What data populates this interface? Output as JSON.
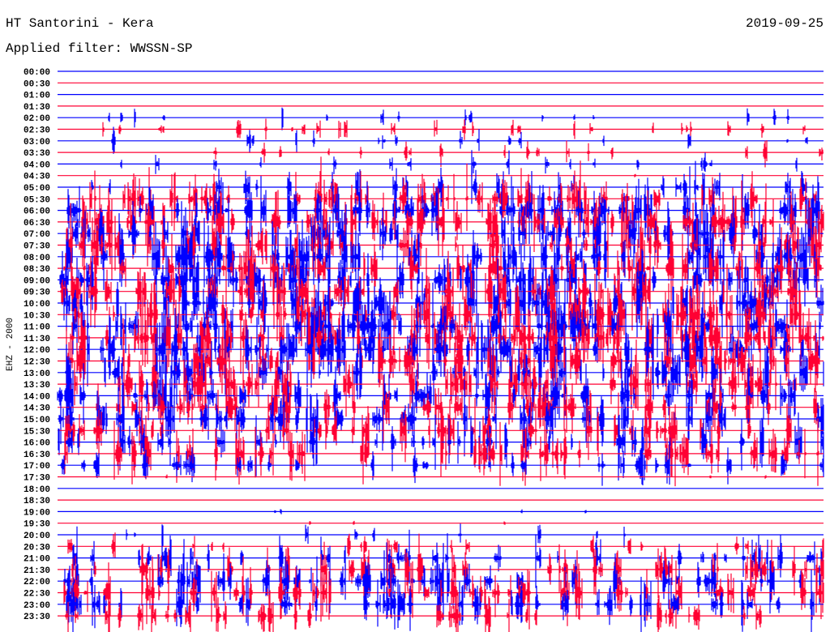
{
  "header": {
    "station": "HT Santorini - Kera",
    "date": "2019-09-25",
    "filter": "Applied filter: WWSSN-SP"
  },
  "chart_data": {
    "type": "line",
    "title": "HT Santorini - Kera",
    "subtitle": "Applied filter: WWSSN-SP",
    "ylabel": "EHZ - 2000",
    "xlabel": "",
    "grid": false,
    "colors": [
      "#0000ff",
      "#ff0033"
    ],
    "tick_labels": [
      "00:00",
      "00:30",
      "01:00",
      "01:30",
      "02:00",
      "02:30",
      "03:00",
      "03:30",
      "04:00",
      "04:30",
      "05:00",
      "05:30",
      "06:00",
      "06:30",
      "07:00",
      "07:30",
      "08:00",
      "08:30",
      "09:00",
      "09:30",
      "10:00",
      "10:30",
      "11:00",
      "11:30",
      "12:00",
      "12:30",
      "13:00",
      "13:30",
      "14:00",
      "14:30",
      "15:00",
      "15:30",
      "16:00",
      "16:30",
      "17:00",
      "17:30",
      "18:00",
      "18:30",
      "19:00",
      "19:30",
      "20:00",
      "20:30",
      "21:00",
      "21:30",
      "22:00",
      "22:30",
      "23:00",
      "23:30"
    ],
    "activity": [
      0,
      0,
      0,
      0,
      0.25,
      0.3,
      0.3,
      0.3,
      0.3,
      0.05,
      0.5,
      0.8,
      0.9,
      0.9,
      0.95,
      0.95,
      0.95,
      0.9,
      0.9,
      0.95,
      1,
      1,
      1,
      1,
      1,
      1,
      0.9,
      0.85,
      0.85,
      0.8,
      0.85,
      0.85,
      0.8,
      0.8,
      0.5,
      0.03,
      0,
      0,
      0.05,
      0.02,
      0.3,
      0.35,
      0.7,
      0.75,
      0.8,
      0.8,
      0.75,
      0.6
    ]
  }
}
